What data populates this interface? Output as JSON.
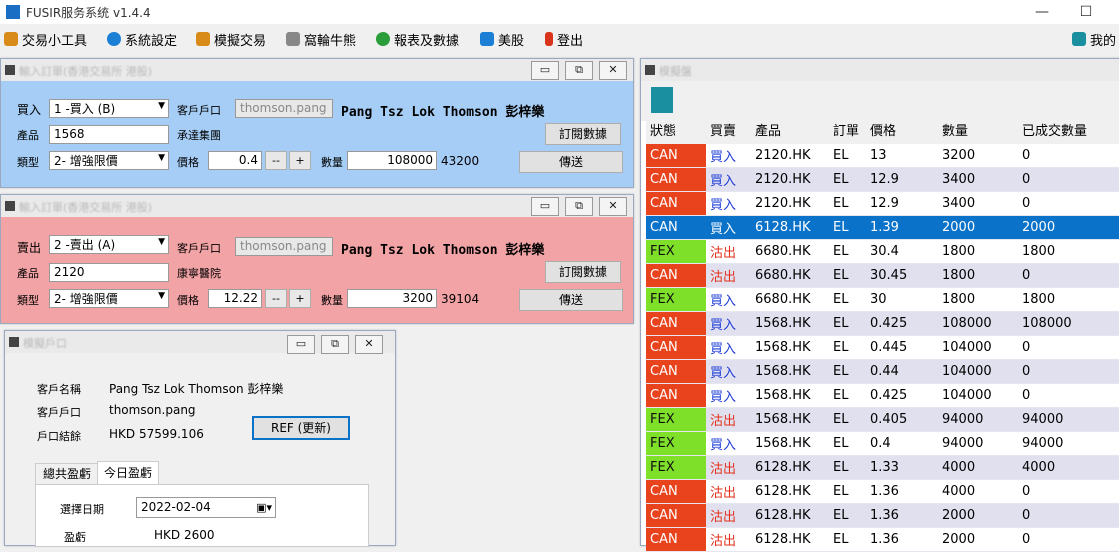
{
  "app": {
    "title": "FUSIR服务系统 v1.4.4"
  },
  "menu": [
    {
      "label": "交易小工具",
      "icon": "tools-icon",
      "color": "#d98b1a"
    },
    {
      "label": "系統設定",
      "icon": "info-icon",
      "color": "#1c7fd6"
    },
    {
      "label": "模擬交易",
      "icon": "book-icon",
      "color": "#d98b1a"
    },
    {
      "label": "窩輪牛熊",
      "icon": "grid-icon",
      "color": "#555555"
    },
    {
      "label": "報表及數據",
      "icon": "globe-icon",
      "color": "#2a9d3a"
    },
    {
      "label": "美股",
      "icon": "calendar-icon",
      "color": "#1c7fd6"
    },
    {
      "label": "登出",
      "icon": "logout-icon",
      "color": "#d9331c"
    }
  ],
  "menu_right": "我的",
  "buy_order": {
    "title": "輸入訂單(香港交易所 港股)",
    "side_label": "買入",
    "side_value": "1 -買入 (B)",
    "account_label": "客戶戶口",
    "account_value": "thomson.pang",
    "client_name": "Pang Tsz Lok Thomson  彭梓樂",
    "product_label": "產品",
    "product_code": "1568",
    "product_name": "承達集團",
    "order_book_btn": "訂閱數據",
    "type_label": "類型",
    "type_value": "2- 增強限價",
    "price_label": "價格",
    "price_value": "0.4",
    "minus": "--",
    "plus": "+",
    "qty_label": "數量",
    "qty_value": "108000",
    "amount": "43200",
    "send_btn": "傳送",
    "bg_color": "#a6cdf5"
  },
  "sell_order": {
    "title": "輸入訂單(香港交易所 港股)",
    "side_label": "賣出",
    "side_value": "2 -賣出 (A)",
    "account_label": "客戶戶口",
    "account_value": "thomson.pang",
    "client_name": "Pang Tsz Lok Thomson  彭梓樂",
    "product_label": "產品",
    "product_code": "2120",
    "product_name": "康寧醫院",
    "order_book_btn": "訂閱數據",
    "type_label": "類型",
    "type_value": "2- 增強限價",
    "price_label": "價格",
    "price_value": "12.22",
    "minus": "--",
    "plus": "+",
    "qty_label": "數量",
    "qty_value": "3200",
    "amount": "39104",
    "send_btn": "傳送",
    "bg_color": "#f2a3a5"
  },
  "account": {
    "title": "模擬戶口",
    "name_label": "客戶名稱",
    "name_value": "Pang Tsz Lok Thomson  彭梓樂",
    "acct_label": "客戶戶口",
    "acct_value": "thomson.pang",
    "balance_label": "戶口結餘",
    "balance_value": "HKD 57599.106",
    "ref_btn": "REF (更新)",
    "tabs": [
      "總共盈虧",
      "今日盈虧"
    ],
    "date_label": "選擇日期",
    "date_value": "2022-02-04",
    "pnl_label": "盈虧",
    "pnl_value": "HKD 2600"
  },
  "orders_panel": {
    "title": "模擬盤",
    "headers": [
      "狀態",
      "買賣",
      "產品",
      "訂單",
      "價格",
      "數量",
      "已成交數量"
    ],
    "rows": [
      [
        "CAN",
        "買入",
        "2120.HK",
        "EL",
        "13",
        "3200",
        "0"
      ],
      [
        "CAN",
        "買入",
        "2120.HK",
        "EL",
        "12.9",
        "3400",
        "0"
      ],
      [
        "CAN",
        "買入",
        "2120.HK",
        "EL",
        "12.9",
        "3400",
        "0"
      ],
      [
        "CAN",
        "買入",
        "6128.HK",
        "EL",
        "1.39",
        "2000",
        "2000"
      ],
      [
        "FEX",
        "沽出",
        "6680.HK",
        "EL",
        "30.4",
        "1800",
        "1800"
      ],
      [
        "CAN",
        "沽出",
        "6680.HK",
        "EL",
        "30.45",
        "1800",
        "0"
      ],
      [
        "FEX",
        "買入",
        "6680.HK",
        "EL",
        "30",
        "1800",
        "1800"
      ],
      [
        "CAN",
        "買入",
        "1568.HK",
        "EL",
        "0.425",
        "108000",
        "108000"
      ],
      [
        "CAN",
        "買入",
        "1568.HK",
        "EL",
        "0.445",
        "104000",
        "0"
      ],
      [
        "CAN",
        "買入",
        "1568.HK",
        "EL",
        "0.44",
        "104000",
        "0"
      ],
      [
        "CAN",
        "買入",
        "1568.HK",
        "EL",
        "0.425",
        "104000",
        "0"
      ],
      [
        "FEX",
        "沽出",
        "1568.HK",
        "EL",
        "0.405",
        "94000",
        "94000"
      ],
      [
        "FEX",
        "買入",
        "1568.HK",
        "EL",
        "0.4",
        "94000",
        "94000"
      ],
      [
        "FEX",
        "沽出",
        "6128.HK",
        "EL",
        "1.33",
        "4000",
        "4000"
      ],
      [
        "CAN",
        "沽出",
        "6128.HK",
        "EL",
        "1.36",
        "4000",
        "0"
      ],
      [
        "CAN",
        "沽出",
        "6128.HK",
        "EL",
        "1.36",
        "2000",
        "0"
      ],
      [
        "CAN",
        "沽出",
        "6128.HK",
        "EL",
        "1.36",
        "2000",
        "0"
      ]
    ],
    "selected_row": 3
  }
}
